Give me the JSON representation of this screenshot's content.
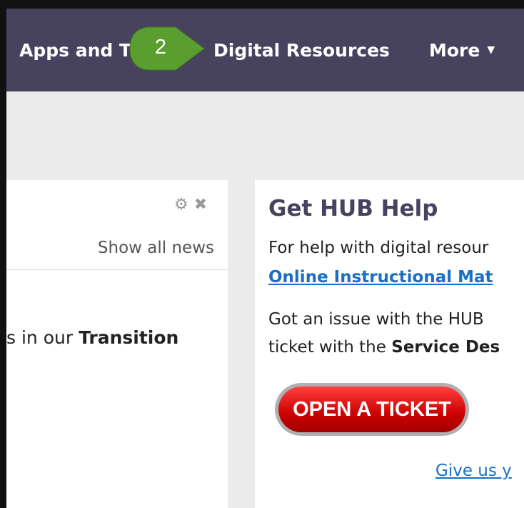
{
  "nav": {
    "items": [
      {
        "label": "Apps and T"
      },
      {
        "label": "Digital Resources"
      },
      {
        "label": "More"
      }
    ]
  },
  "callout": {
    "number": "2",
    "color": "#5a9e2f"
  },
  "news_widget": {
    "show_all_label": "Show all news",
    "text_pre": "s in our ",
    "text_bold": "Transition"
  },
  "help_widget": {
    "title": "Get HUB Help",
    "line1": "For help with digital resour",
    "link1": "Online Instructional Mat",
    "line3": "Got an issue with the HUB",
    "line4_pre": "ticket with the ",
    "line4_bold": "Service Des",
    "ticket_button": "OPEN A TICKET",
    "feedback_link": "Give us y"
  },
  "colors": {
    "navbar": "#47425e",
    "link": "#1a6fc4",
    "ticket": "#cc0000"
  }
}
